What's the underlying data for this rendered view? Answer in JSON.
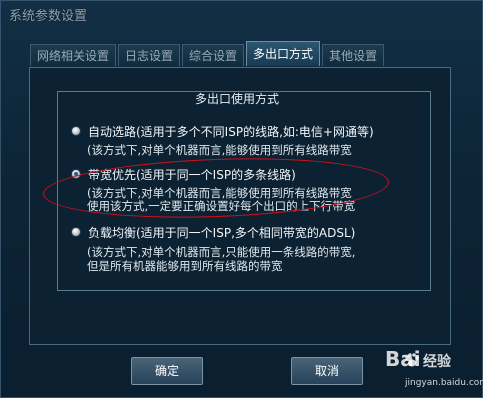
{
  "window": {
    "title": "系统参数设置"
  },
  "tabs": [
    {
      "label": "网络相关设置",
      "active": false
    },
    {
      "label": "日志设置",
      "active": false
    },
    {
      "label": "综合设置",
      "active": false
    },
    {
      "label": "多出口方式",
      "active": true
    },
    {
      "label": "其他设置",
      "active": false
    }
  ],
  "group": {
    "title": "多出口使用方式",
    "options": [
      {
        "label": "自动选路(适用于多个不同ISP的线路,如:电信+网通等)",
        "checked": false,
        "desc": [
          "(该方式下,对单个机器而言,能够使用到所有线路带宽"
        ]
      },
      {
        "label": "带宽优先(适用于同一个ISP的多条线路)",
        "checked": true,
        "desc": [
          "(该方式下,对单个机器而言,能够使用到所有线路带宽",
          "使用该方式,一定要正确设置好每个出口的上下行带宽"
        ]
      },
      {
        "label": "负载均衡(适用于同一个ISP,多个相同带宽的ADSL)",
        "checked": false,
        "desc": [
          "(该方式下,对单个机器而言,只能使用一条线路的带宽,",
          "但是所有机器能够用到所有线路的带宽"
        ]
      }
    ]
  },
  "buttons": {
    "ok": "确定",
    "cancel": "取消"
  },
  "watermark": {
    "logo": "Bai",
    "text": "经验",
    "url": "jingyan.baidu.com"
  },
  "colors": {
    "highlight_ellipse": "#d0101a",
    "background": "#0a1e2c"
  }
}
